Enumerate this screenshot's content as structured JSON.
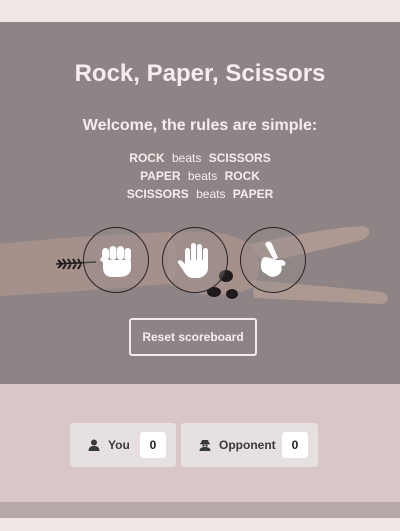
{
  "title": "Rock, Paper, Scissors",
  "welcome": "Welcome, the rules are simple:",
  "rules": [
    {
      "winner": "ROCK",
      "verb": "beats",
      "loser": "SCISSORS"
    },
    {
      "winner": "PAPER",
      "verb": "beats",
      "loser": "ROCK"
    },
    {
      "winner": "SCISSORS",
      "verb": "beats",
      "loser": "PAPER"
    }
  ],
  "choices": [
    {
      "name": "rock",
      "icon": "fist-icon"
    },
    {
      "name": "paper",
      "icon": "open-hand-icon"
    },
    {
      "name": "scissors",
      "icon": "scissors-hand-icon"
    }
  ],
  "reset_label": "Reset scoreboard",
  "scoreboard": {
    "you": {
      "label": "You",
      "score": "0",
      "icon": "user-icon"
    },
    "opponent": {
      "label": "Opponent",
      "score": "0",
      "icon": "user-secret-icon"
    }
  },
  "colors": {
    "hero": "#8e8485",
    "lower_panel": "#d9c6c6",
    "text_light": "#f4eeee"
  }
}
